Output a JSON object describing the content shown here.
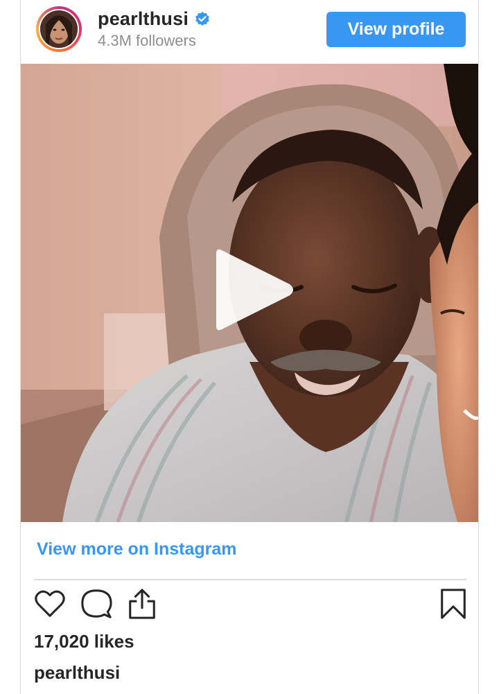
{
  "header": {
    "username": "pearlthusi",
    "followers": "4.3M followers",
    "view_profile_label": "View profile"
  },
  "post": {
    "media_type": "video",
    "more_link_label": "View more on Instagram",
    "likes": "17,020 likes",
    "caption_username": "pearlthusi"
  },
  "icons": {
    "verified": "verified-badge-icon",
    "play": "play-icon",
    "like": "heart-icon",
    "comment": "comment-bubble-icon",
    "share": "share-icon",
    "save": "bookmark-icon"
  },
  "colors": {
    "accent_blue": "#3897f0",
    "text_primary": "#262626",
    "text_secondary": "#8e8e8e",
    "divider": "#dbdbdb"
  }
}
